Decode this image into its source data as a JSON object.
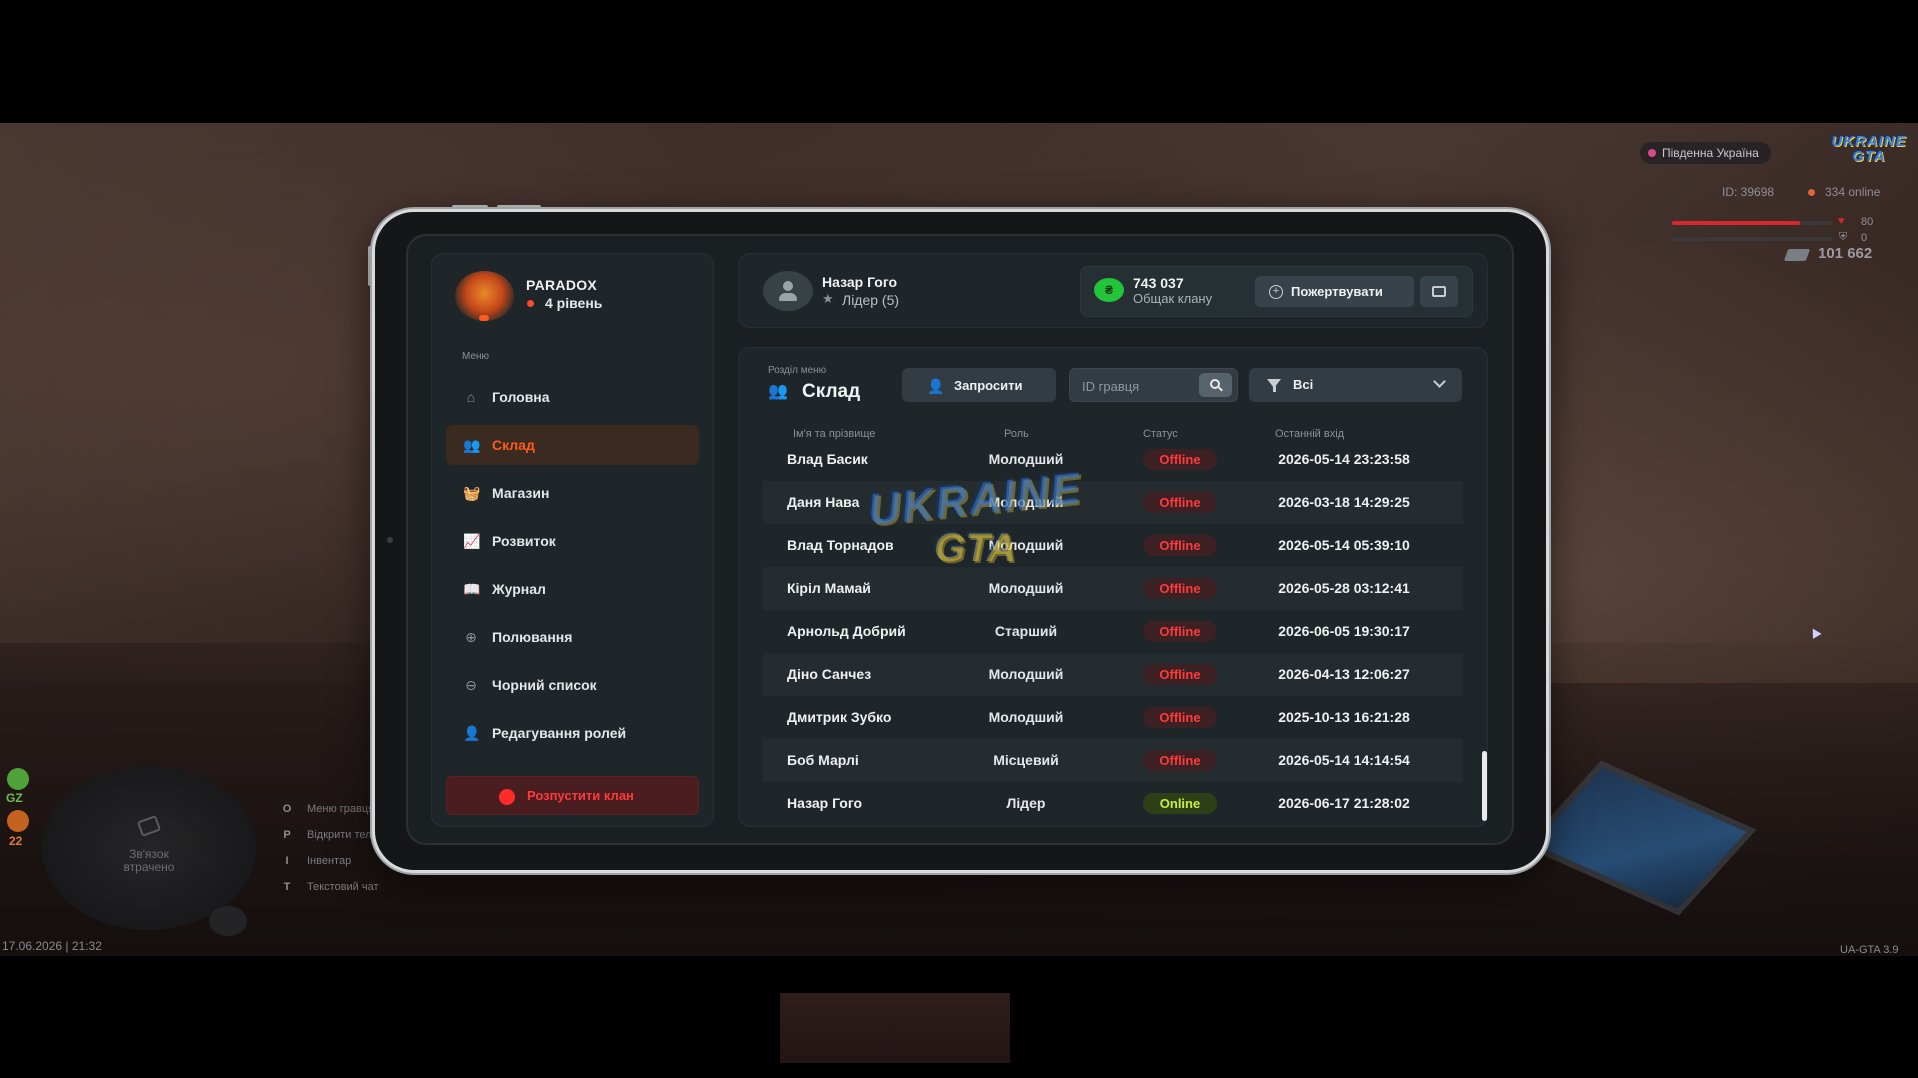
{
  "hud": {
    "server_name": "Південна Україна",
    "logo_text": "UKRAINE GTA",
    "player_id": "ID: 39698",
    "online": "334 online",
    "health": "80",
    "health_fraction": 0.8,
    "armor": "0",
    "armor_fraction": 0,
    "money": "101 662",
    "gz_label": "GZ",
    "wanted_count": "22",
    "radar_text": "Зв'язок втрачено",
    "hotkeys": [
      {
        "key": "O",
        "label": "Меню гравця"
      },
      {
        "key": "P",
        "label": "Відкрити телефон"
      },
      {
        "key": "I",
        "label": "Інвентар"
      },
      {
        "key": "T",
        "label": "Текстовий чат"
      }
    ],
    "datetime": "17.06.2026 | 21:32",
    "version": "UA-GTA 3.9",
    "colors": {
      "health": "#d8272b",
      "gz": "#6cbf4a",
      "wanted": "#e07b3a"
    }
  },
  "clan": {
    "name": "PARADOX",
    "level": "4 рівень"
  },
  "sidebar": {
    "caption": "Меню",
    "items": [
      {
        "label": "Головна",
        "icon": "home-icon",
        "glyph": "⌂",
        "active": false
      },
      {
        "label": "Склад",
        "icon": "people-icon",
        "glyph": "👥",
        "active": true
      },
      {
        "label": "Магазин",
        "icon": "basket-icon",
        "glyph": "🧺",
        "active": false
      },
      {
        "label": "Розвиток",
        "icon": "chart-icon",
        "glyph": "📈",
        "active": false
      },
      {
        "label": "Журнал",
        "icon": "book-icon",
        "glyph": "📖",
        "active": false
      },
      {
        "label": "Полювання",
        "icon": "target-icon",
        "glyph": "⊕",
        "active": false
      },
      {
        "label": "Чорний список",
        "icon": "blocked-icon",
        "glyph": "⊖",
        "active": false
      },
      {
        "label": "Редагування ролей",
        "icon": "user-edit-icon",
        "glyph": "👤",
        "active": false
      }
    ],
    "disband_label": "Розпустити клан"
  },
  "header": {
    "user_name": "Назар Гого",
    "user_role": "Лідер (5)",
    "bank_amount": "743 037",
    "bank_label": "Общак клану",
    "bank_icon_glyph": "₴",
    "donate_label": "Пожертвувати",
    "donate_icon_glyph": "+"
  },
  "section": {
    "caption": "Розділ меню",
    "title": "Склад",
    "title_icon_glyph": "👥",
    "invite_label": "Запросити",
    "invite_icon_glyph": "👤",
    "search_placeholder": "ID гравця",
    "filter_value": "Всі"
  },
  "table": {
    "headers": [
      "Ім'я та прізвище",
      "Роль",
      "Статус",
      "Останній вхід"
    ],
    "rows": [
      {
        "name": "Влад Басик",
        "role": "Молодший",
        "status": "Offline",
        "online": false,
        "last": "2026-05-14 23:23:58"
      },
      {
        "name": "Даня Нава",
        "role": "Молодший",
        "status": "Offline",
        "online": false,
        "last": "2026-03-18 14:29:25"
      },
      {
        "name": "Влад Торнадов",
        "role": "Молодший",
        "status": "Offline",
        "online": false,
        "last": "2026-05-14 05:39:10"
      },
      {
        "name": "Кіріл Мамай",
        "role": "Молодший",
        "status": "Offline",
        "online": false,
        "last": "2026-05-28 03:12:41"
      },
      {
        "name": "Арнольд Добрий",
        "role": "Старший",
        "status": "Offline",
        "online": false,
        "last": "2026-06-05 19:30:17"
      },
      {
        "name": "Діно Санчез",
        "role": "Молодший",
        "status": "Offline",
        "online": false,
        "last": "2026-04-13 12:06:27"
      },
      {
        "name": "Дмитрик Зубко",
        "role": "Молодший",
        "status": "Offline",
        "online": false,
        "last": "2025-10-13 16:21:28"
      },
      {
        "name": "Боб Марлі",
        "role": "Місцевий",
        "status": "Offline",
        "online": false,
        "last": "2026-05-14 14:14:54"
      },
      {
        "name": "Назар Гого",
        "role": "Лідер",
        "status": "Online",
        "online": true,
        "last": "2026-06-17 21:28:02"
      }
    ]
  },
  "colors": {
    "accent": "#ff5a1f",
    "offline": "#ff3a3a",
    "online": "#c8f03a",
    "panel": "#1f2629",
    "screen": "#1a1f22",
    "bank": "#22c43a"
  },
  "watermark": {
    "line1": "UKRAINE",
    "line2": "GTA"
  }
}
